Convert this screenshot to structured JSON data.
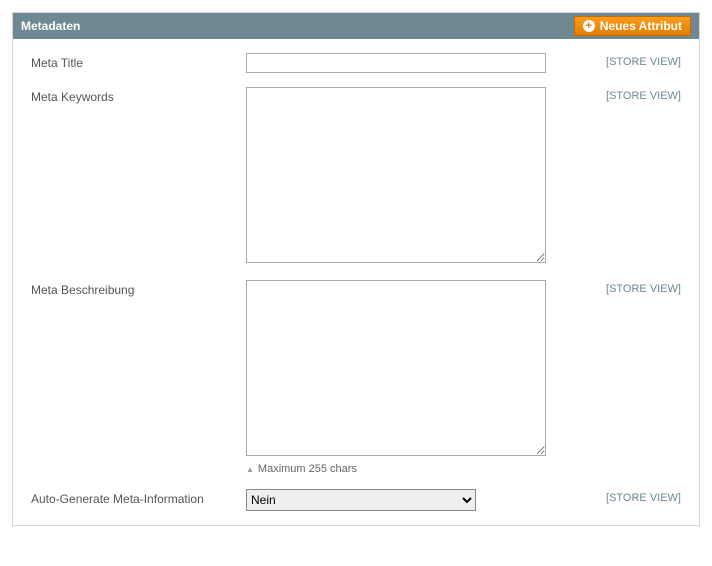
{
  "panel": {
    "title": "Metadaten",
    "new_button": "Neues Attribut"
  },
  "scope": "[STORE VIEW]",
  "fields": {
    "meta_title": {
      "label": "Meta Title",
      "value": ""
    },
    "meta_keywords": {
      "label": "Meta Keywords",
      "value": ""
    },
    "meta_description": {
      "label": "Meta Beschreibung",
      "value": "",
      "note": "Maximum 255 chars"
    },
    "auto_generate": {
      "label": "Auto-Generate Meta-Information",
      "selected": "Nein"
    }
  }
}
